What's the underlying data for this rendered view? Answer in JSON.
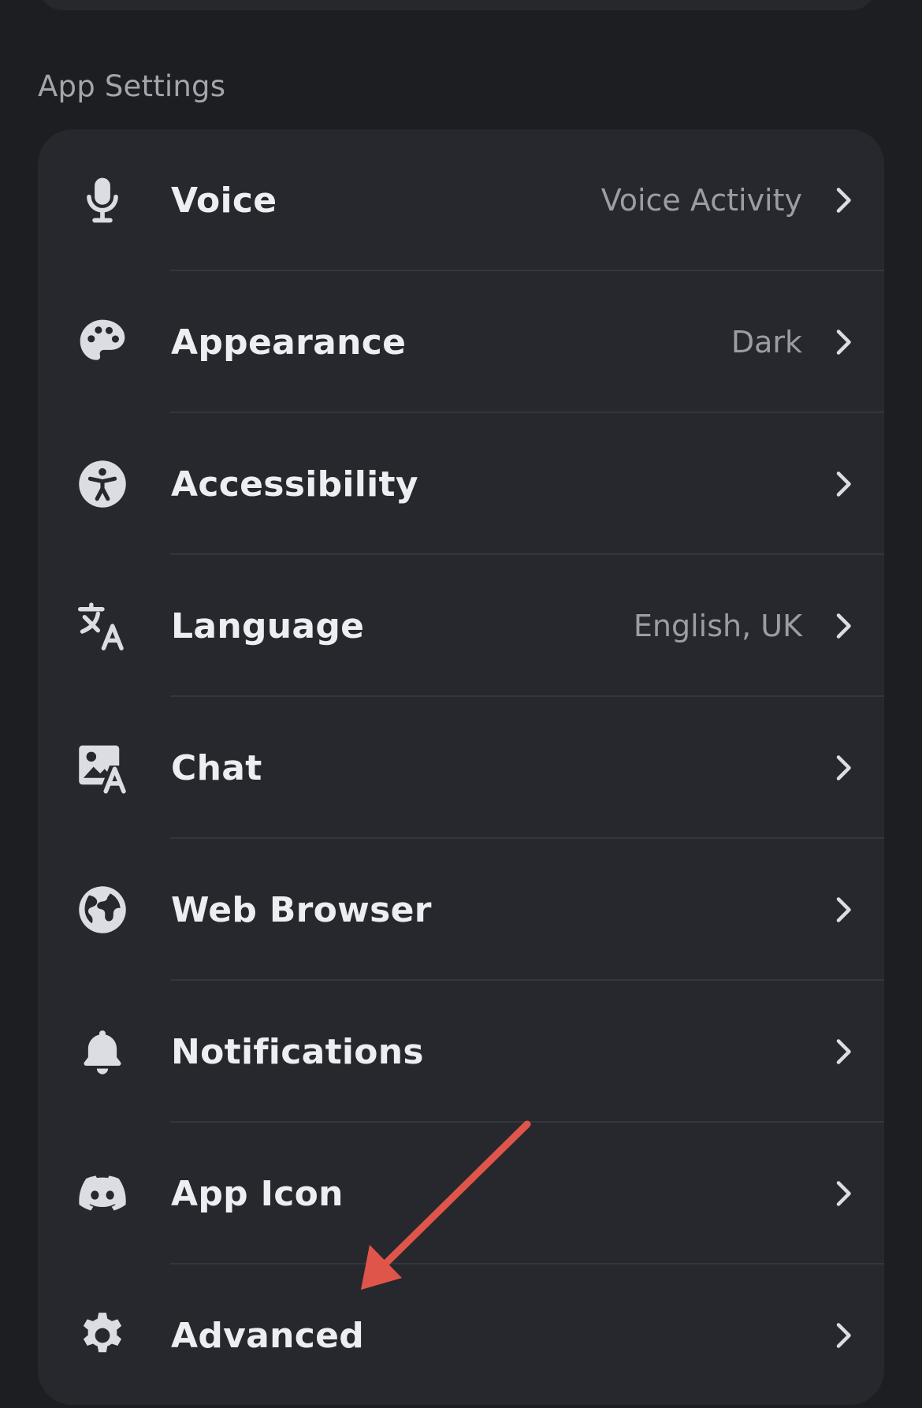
{
  "section_title": "App Settings",
  "rows": [
    {
      "label": "Voice",
      "value": "Voice Activity",
      "icon": "microphone-icon"
    },
    {
      "label": "Appearance",
      "value": "Dark",
      "icon": "palette-icon"
    },
    {
      "label": "Accessibility",
      "value": "",
      "icon": "accessibility-icon"
    },
    {
      "label": "Language",
      "value": "English, UK",
      "icon": "translate-icon"
    },
    {
      "label": "Chat",
      "value": "",
      "icon": "image-text-icon"
    },
    {
      "label": "Web Browser",
      "value": "",
      "icon": "globe-icon"
    },
    {
      "label": "Notifications",
      "value": "",
      "icon": "bell-icon"
    },
    {
      "label": "App Icon",
      "value": "",
      "icon": "discord-icon"
    },
    {
      "label": "Advanced",
      "value": "",
      "icon": "gear-icon"
    }
  ],
  "colors": {
    "background": "#1d1e22",
    "card": "#27282e",
    "icon": "#dcdde2",
    "secondary_text": "#9b9da5",
    "annotation_arrow": "#e0554a"
  }
}
